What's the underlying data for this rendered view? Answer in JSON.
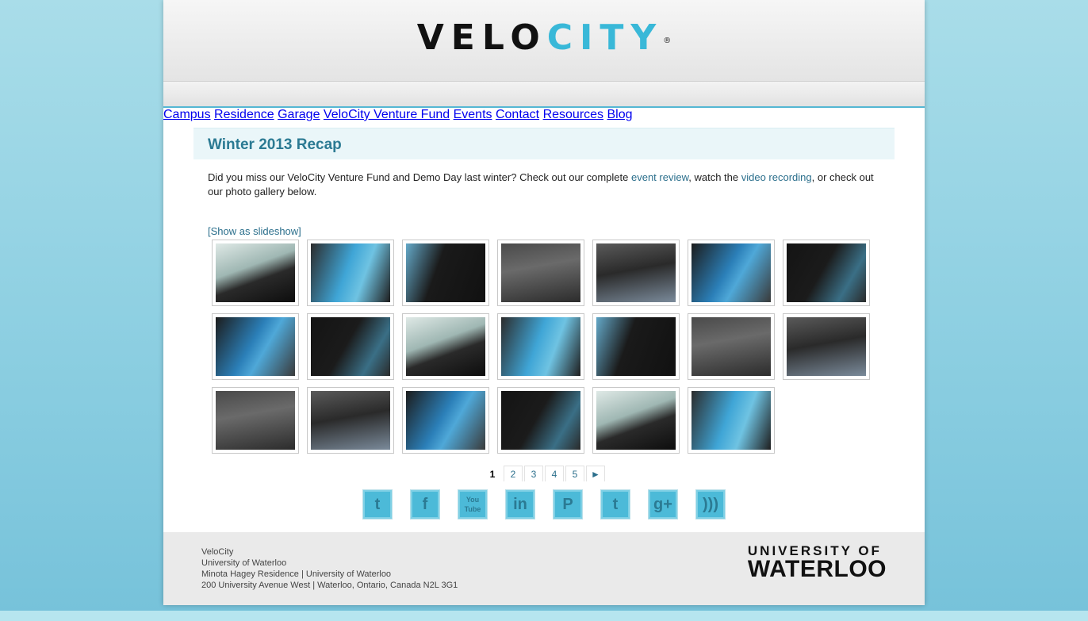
{
  "brand": {
    "part1": "VELO",
    "part2": "CITY",
    "mark": "®"
  },
  "nav": [
    "Campus",
    "Residence",
    "Garage",
    "VeloCity Venture Fund",
    "Events",
    "Contact",
    "Resources",
    "Blog"
  ],
  "content": {
    "title": "Winter 2013 Recap",
    "intro_pre": "Did you miss our VeloCity Venture Fund and Demo Day last winter? Check out our complete ",
    "link_event": "event review",
    "intro_mid": ", watch the ",
    "link_video": "video recording",
    "intro_post": ", or check out our photo gallery below.",
    "slideshow": "[Show as slideshow]"
  },
  "gallery": {
    "count": 20
  },
  "pager": {
    "current": "1",
    "pages": [
      "2",
      "3",
      "4",
      "5"
    ],
    "next": "►"
  },
  "social": [
    "twitter-icon",
    "facebook-icon",
    "youtube-icon",
    "linkedin-icon",
    "pinterest-icon",
    "tumblr-icon",
    "googleplus-icon",
    "rss-icon"
  ],
  "social_glyphs": [
    "t",
    "f",
    "You Tube",
    "in",
    "P",
    "t",
    "g+",
    ")))"
  ],
  "footer": {
    "line1": "VeloCity",
    "line2": "University of Waterloo",
    "line3": "Minota Hagey Residence | University of Waterloo",
    "line4": "200 University Avenue West | Waterloo, Ontario, Canada N2L 3G1",
    "uw1": "UNIVERSITY OF",
    "uw2": "WATERLOO"
  }
}
